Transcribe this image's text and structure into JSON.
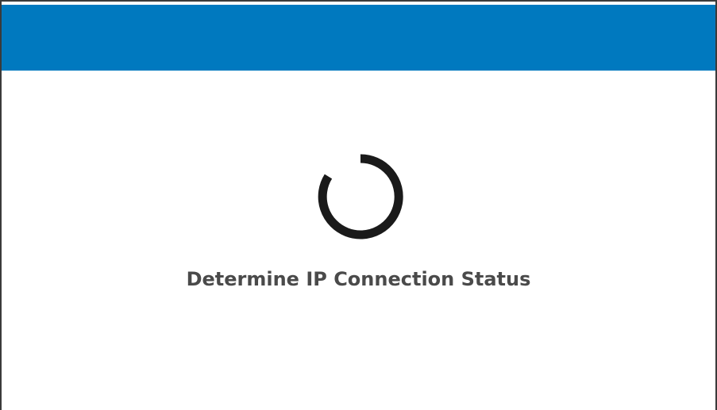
{
  "header": {
    "color": "#0079bf"
  },
  "loading": {
    "icon": "loading-spinner-icon",
    "status_text": "Determine IP Connection Status"
  }
}
